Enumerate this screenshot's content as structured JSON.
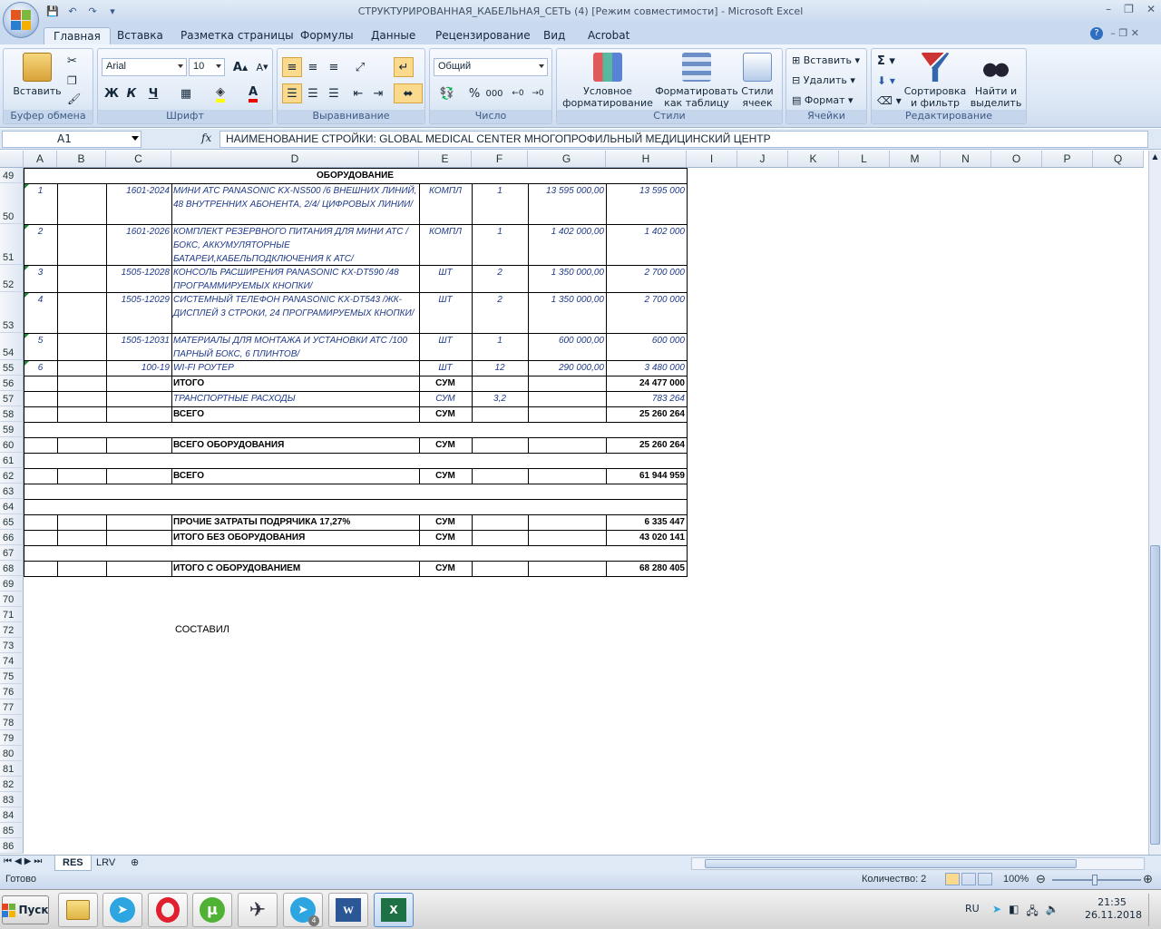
{
  "window": {
    "title": "СТРУКТУРИРОВАННАЯ_КАБЕЛЬНАЯ_СЕТЬ (4)  [Режим совместимости] - Microsoft Excel"
  },
  "ribbon_tabs": [
    "Главная",
    "Вставка",
    "Разметка страницы",
    "Формулы",
    "Данные",
    "Рецензирование",
    "Вид",
    "Acrobat"
  ],
  "ribbon": {
    "clipboard": {
      "paste": "Вставить",
      "label": "Буфер обмена"
    },
    "font": {
      "name": "Arial",
      "size": "10",
      "label": "Шрифт",
      "bold": "Ж",
      "italic": "К",
      "underline": "Ч"
    },
    "alignment": {
      "label": "Выравнивание"
    },
    "number": {
      "format": "Общий",
      "label": "Число",
      "percent": "%",
      "thousands": "000"
    },
    "styles": {
      "cond1": "Условное",
      "cond2": "форматирование",
      "table1": "Форматировать",
      "table2": "как таблицу",
      "cell1": "Стили",
      "cell2": "ячеек",
      "label": "Стили"
    },
    "cells": {
      "insert": "Вставить",
      "delete": "Удалить",
      "format": "Формат",
      "label": "Ячейки"
    },
    "editing": {
      "sort1": "Сортировка",
      "sort2": "и фильтр",
      "find1": "Найти и",
      "find2": "выделить",
      "label": "Редактирование"
    }
  },
  "formula_bar": {
    "name_box": "A1",
    "fx": "fx",
    "content": "НАИМЕНОВАНИЕ СТРОЙКИ: GLOBAL MEDICAL CENTER МНОГОПРОФИЛЬНЫЙ МЕДИЦИНСКИЙ ЦЕНТР"
  },
  "columns": [
    "A",
    "B",
    "C",
    "D",
    "E",
    "F",
    "G",
    "H",
    "I",
    "J",
    "K",
    "L",
    "M",
    "N",
    "O",
    "P",
    "Q"
  ],
  "row_numbers": [
    "49",
    "50",
    "51",
    "52",
    "53",
    "54",
    "55",
    "56",
    "57",
    "58",
    "59",
    "60",
    "61",
    "62",
    "63",
    "64",
    "65",
    "66",
    "67",
    "68",
    "69",
    "70",
    "71",
    "72",
    "73",
    "74",
    "75",
    "76",
    "77",
    "78",
    "79",
    "80",
    "81",
    "82",
    "83",
    "84",
    "85",
    "86"
  ],
  "sheet": {
    "section_header": "ОБОРУДОВАНИЕ",
    "items": [
      {
        "num": "1",
        "code": "1601-2024",
        "name": "МИНИ АТС PANASONIC KX-NS500 /6 ВНЕШНИХ ЛИНИЙ, 48 ВНУТРЕННИХ АБОНЕНТА, 2/4/ ЦИФРОВЫХ ЛИНИИ/",
        "unit": "КОМПЛ",
        "qty": "1",
        "price": "13 595 000,00",
        "total": "13 595 000"
      },
      {
        "num": "2",
        "code": "1601-2026",
        "name": "КОМПЛЕКТ РЕЗЕРВНОГО ПИТАНИЯ ДЛЯ МИНИ АТС /БОКС, АККУМУЛЯТОРНЫЕ БАТАРЕИ,КАБЕЛЬПОДКЛЮЧЕНИЯ К АТС/",
        "unit": "КОМПЛ",
        "qty": "1",
        "price": "1 402 000,00",
        "total": "1 402 000"
      },
      {
        "num": "3",
        "code": "1505-12028",
        "name": "КОНСОЛЬ РАСШИРЕНИЯ PANASONIC KX-DT590 /48 ПРОГРАММИРУЕМЫХ КНОПКИ/",
        "unit": "ШТ",
        "qty": "2",
        "price": "1 350 000,00",
        "total": "2 700 000"
      },
      {
        "num": "4",
        "code": "1505-12029",
        "name": "СИСТЕМНЫЙ ТЕЛЕФОН PANASONIC KX-DT543 /ЖК-ДИСПЛЕЙ 3 СТРОКИ, 24 ПРОГРАМИРУЕМЫХ КНОПКИ/",
        "unit": "ШТ",
        "qty": "2",
        "price": "1 350 000,00",
        "total": "2 700 000"
      },
      {
        "num": "5",
        "code": "1505-12031",
        "name": "МАТЕРИАЛЫ ДЛЯ МОНТАЖА И УСТАНОВКИ АТС /100 ПАРНЫЙ БОКС, 6 ПЛИНТОВ/",
        "unit": "ШТ",
        "qty": "1",
        "price": "600 000,00",
        "total": "600 000"
      },
      {
        "num": "6",
        "code": "100-19",
        "name": "WI-FI РОУТЕР",
        "unit": "ШТ",
        "qty": "12",
        "price": "290 000,00",
        "total": "3 480 000"
      }
    ],
    "totals": {
      "itogo": {
        "label": "ИТОГО",
        "unit": "СУМ",
        "value": "24 477 000"
      },
      "transport": {
        "label": "ТРАНСПОРТНЫЕ РАСХОДЫ",
        "unit": "СУМ",
        "rate": "3,2",
        "value": "783 264"
      },
      "vsego1": {
        "label": "ВСЕГО",
        "unit": "СУМ",
        "value": "25 260 264"
      },
      "vsego_obor": {
        "label": "ВСЕГО ОБОРУДОВАНИЯ",
        "unit": "СУМ",
        "value": "25 260 264"
      },
      "vsego2": {
        "label": "ВСЕГО",
        "unit": "СУМ",
        "value": "61 944 959"
      },
      "prochie": {
        "label": "ПРОЧИЕ ЗАТРАТЫ ПОДРЯЧИКА 17,27%",
        "unit": "СУМ",
        "value": "6 335 447"
      },
      "bez_obor": {
        "label": "ИТОГО БЕЗ ОБОРУДОВАНИЯ",
        "unit": "СУМ",
        "value": "43 020 141"
      },
      "s_obor": {
        "label": "ИТОГО С ОБОРУДОВАНИЕМ",
        "unit": "СУМ",
        "value": "68 280 405"
      }
    },
    "sostavil": "СОСТАВИЛ"
  },
  "sheet_tabs": [
    "RES",
    "LRV"
  ],
  "status": {
    "ready": "Готово",
    "count": "Количество: 2",
    "zoom": "100%"
  },
  "taskbar": {
    "start": "Пуск",
    "lang": "RU",
    "time": "21:35",
    "date": "26.11.2018",
    "telegram_badge": "4"
  }
}
